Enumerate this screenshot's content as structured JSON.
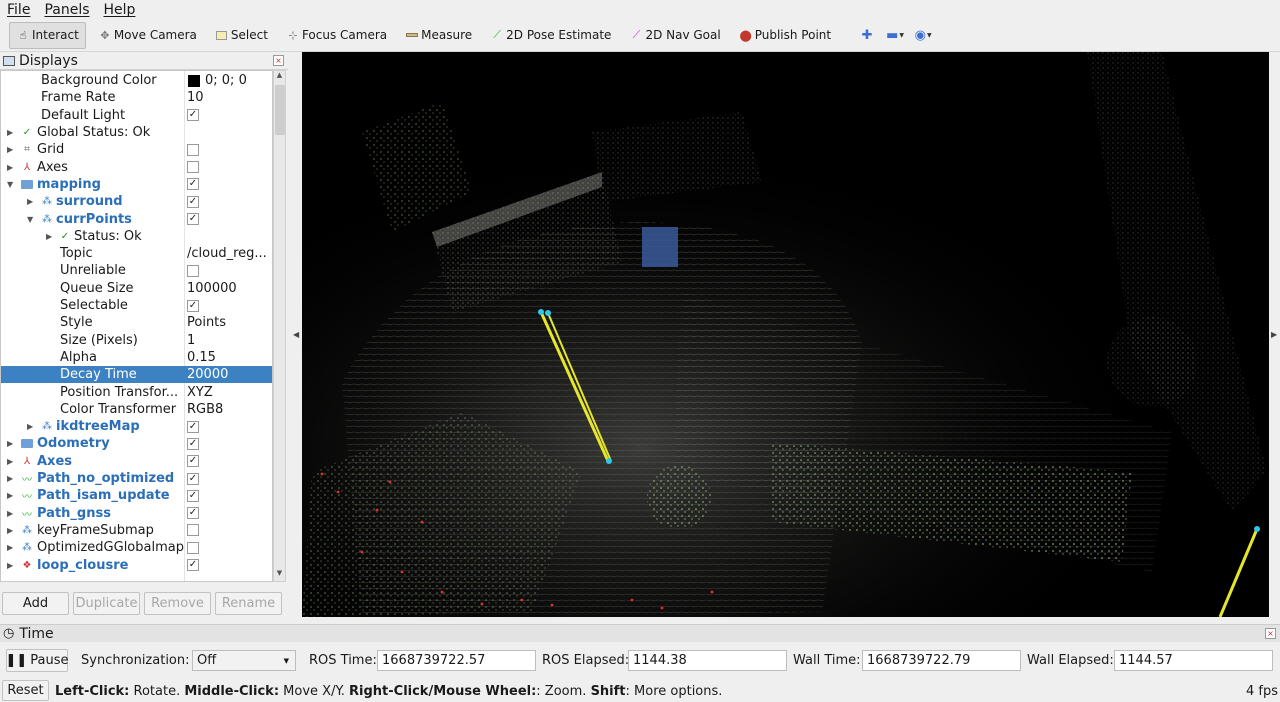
{
  "menu": [
    "File",
    "Panels",
    "Help"
  ],
  "toolbar": {
    "tools": [
      {
        "label": "Interact",
        "icon": "cursor-icon"
      },
      {
        "label": "Move Camera",
        "icon": "move-camera-icon"
      },
      {
        "label": "Select",
        "icon": "select-icon"
      },
      {
        "label": "Focus Camera",
        "icon": "focus-camera-icon"
      },
      {
        "label": "Measure",
        "icon": "ruler-icon"
      },
      {
        "label": "2D Pose Estimate",
        "icon": "green-arrow-icon"
      },
      {
        "label": "2D Nav Goal",
        "icon": "pink-arrow-icon"
      },
      {
        "label": "Publish Point",
        "icon": "map-pin-icon"
      }
    ]
  },
  "displays": {
    "title": "Displays",
    "rows": [
      {
        "name": "Background Color",
        "value": "0; 0; 0"
      },
      {
        "name": "Frame Rate",
        "value": "10"
      },
      {
        "name": "Default Light",
        "check": "✓"
      },
      {
        "name": "Global Status: Ok"
      },
      {
        "name": "Grid",
        "check": ""
      },
      {
        "name": "Axes",
        "check": ""
      },
      {
        "name": "mapping",
        "check": "✓"
      },
      {
        "name": "surround",
        "check": "✓"
      },
      {
        "name": "currPoints",
        "check": "✓"
      },
      {
        "name": "Status: Ok"
      },
      {
        "name": "Topic",
        "value": "/cloud_reg..."
      },
      {
        "name": "Unreliable",
        "check": ""
      },
      {
        "name": "Queue Size",
        "value": "100000"
      },
      {
        "name": "Selectable",
        "check": "✓"
      },
      {
        "name": "Style",
        "value": "Points"
      },
      {
        "name": "Size (Pixels)",
        "value": "1"
      },
      {
        "name": "Alpha",
        "value": "0.15"
      },
      {
        "name": "Decay Time",
        "value": "20000"
      },
      {
        "name": "Position Transfor...",
        "value": "XYZ"
      },
      {
        "name": "Color Transformer",
        "value": "RGB8"
      },
      {
        "name": "ikdtreeMap",
        "check": "✓"
      },
      {
        "name": "Odometry",
        "check": "✓"
      },
      {
        "name": "Axes",
        "check": "✓"
      },
      {
        "name": "Path_no_optimized",
        "check": "✓"
      },
      {
        "name": "Path_isam_update",
        "check": "✓"
      },
      {
        "name": "Path_gnss",
        "check": "✓"
      },
      {
        "name": "keyFrameSubmap",
        "check": ""
      },
      {
        "name": "OptimizedGGlobalmap",
        "check": ""
      },
      {
        "name": "loop_clousre",
        "check": "✓"
      }
    ],
    "buttons": {
      "add": "Add",
      "duplicate": "Duplicate",
      "remove": "Remove",
      "rename": "Rename"
    }
  },
  "time": {
    "title": "Time",
    "pause_label": "Pause",
    "sync_label": "Synchronization:",
    "sync_value": "Off",
    "ros_time_label": "ROS Time:",
    "ros_time": "1668739722.57",
    "ros_elapsed_label": "ROS Elapsed:",
    "ros_elapsed": "1144.38",
    "wall_time_label": "Wall Time:",
    "wall_time": "1668739722.79",
    "wall_elapsed_label": "Wall Elapsed:",
    "wall_elapsed": "1144.57"
  },
  "status": {
    "reset": "Reset",
    "k1": "Left-Click:",
    "v1": " Rotate. ",
    "k2": "Middle-Click:",
    "v2": " Move X/Y. ",
    "k3": "Right-Click/Mouse Wheel:",
    "v3": ": Zoom. ",
    "k4": "Shift",
    "v4": ": More options.",
    "fps": "4 fps"
  }
}
